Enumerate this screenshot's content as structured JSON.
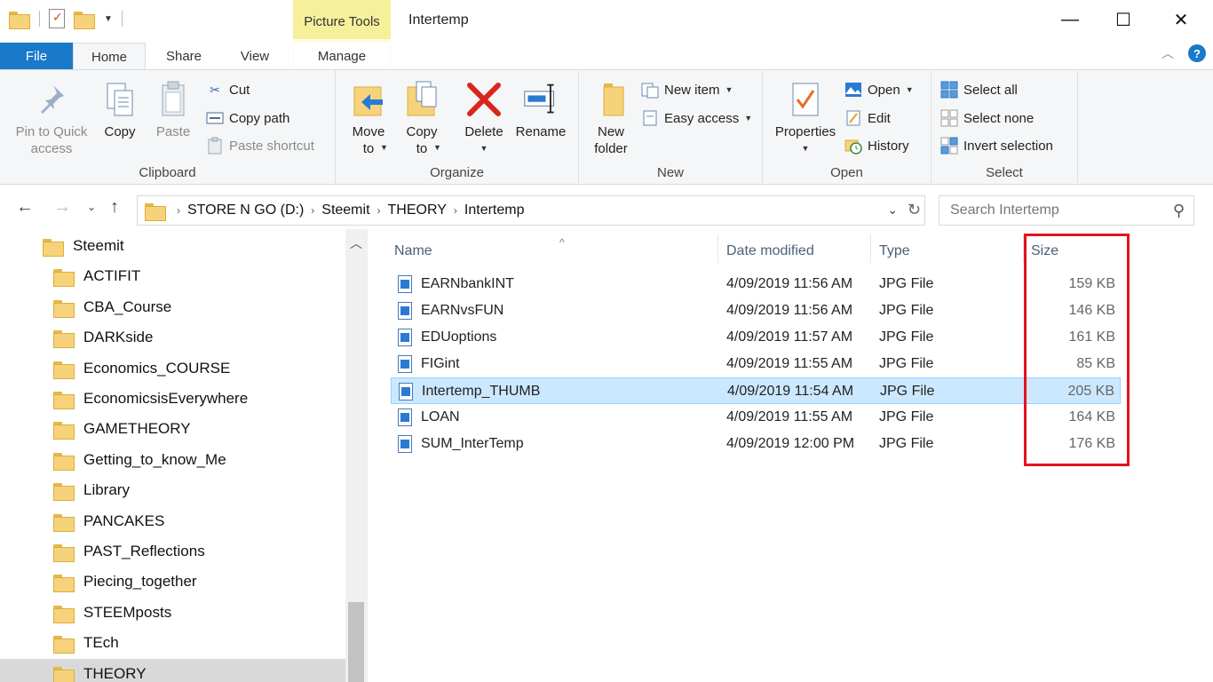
{
  "window": {
    "title": "Intertemp",
    "context_tab": "Picture Tools",
    "minimize": "—",
    "maximize": "☐",
    "close": "✕"
  },
  "tabs": [
    "File",
    "Home",
    "Share",
    "View",
    "Manage"
  ],
  "ribbon": {
    "clipboard": {
      "label": "Clipboard",
      "pin": "Pin to Quick\naccess",
      "copy": "Copy",
      "paste": "Paste",
      "cut": "Cut",
      "copy_path": "Copy path",
      "paste_shortcut": "Paste shortcut"
    },
    "organize": {
      "label": "Organize",
      "move_to": "Move\nto",
      "copy_to": "Copy\nto",
      "delete": "Delete",
      "rename": "Rename"
    },
    "new": {
      "label": "New",
      "new_folder": "New\nfolder",
      "new_item": "New item",
      "easy_access": "Easy access"
    },
    "open": {
      "label": "Open",
      "properties": "Properties",
      "open": "Open",
      "edit": "Edit",
      "history": "History"
    },
    "select": {
      "label": "Select",
      "select_all": "Select all",
      "select_none": "Select none",
      "invert": "Invert selection"
    }
  },
  "address": {
    "crumbs": [
      "STORE N GO (D:)",
      "Steemit",
      "THEORY",
      "Intertemp"
    ],
    "search_placeholder": "Search Intertemp"
  },
  "navpane": {
    "items": [
      "Steemit",
      "ACTIFIT",
      "CBA_Course",
      "DARKside",
      "Economics_COURSE",
      "EconomicsisEverywhere",
      "GAMETHEORY",
      "Getting_to_know_Me",
      "Library",
      "PANCAKES",
      "PAST_Reflections",
      "Piecing_together",
      "STEEMposts",
      "TEch",
      "THEORY"
    ],
    "selected": "THEORY"
  },
  "columns": {
    "name": "Name",
    "date": "Date modified",
    "type": "Type",
    "size": "Size"
  },
  "files": [
    {
      "name": "EARNbankINT",
      "date": "4/09/2019 11:56 AM",
      "type": "JPG File",
      "size": "159 KB"
    },
    {
      "name": "EARNvsFUN",
      "date": "4/09/2019 11:56 AM",
      "type": "JPG File",
      "size": "146 KB"
    },
    {
      "name": "EDUoptions",
      "date": "4/09/2019 11:57 AM",
      "type": "JPG File",
      "size": "161 KB"
    },
    {
      "name": "FIGint",
      "date": "4/09/2019 11:55 AM",
      "type": "JPG File",
      "size": "85 KB"
    },
    {
      "name": "Intertemp_THUMB",
      "date": "4/09/2019 11:54 AM",
      "type": "JPG File",
      "size": "205 KB"
    },
    {
      "name": "LOAN",
      "date": "4/09/2019 11:55 AM",
      "type": "JPG File",
      "size": "164 KB"
    },
    {
      "name": "SUM_InterTemp",
      "date": "4/09/2019 12:00 PM",
      "type": "JPG File",
      "size": "176 KB"
    }
  ],
  "selected_file": "Intertemp_THUMB",
  "colors": {
    "file_tab": "#1979ca",
    "picture_tools": "#f6f09b",
    "selection": "#cce8ff",
    "highlight_box": "#e3131e"
  }
}
